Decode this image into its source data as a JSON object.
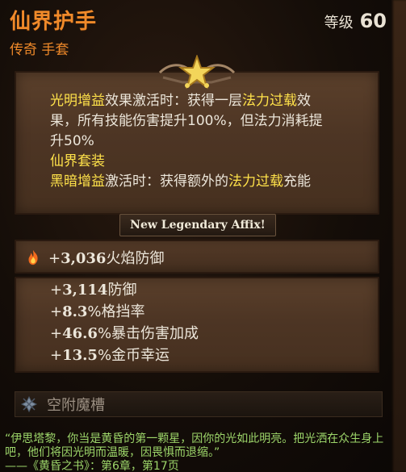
{
  "header": {
    "item_name": "仙界护手",
    "item_subtitle": "传奇 手套",
    "level_label": "等级",
    "level_value": "60"
  },
  "description": {
    "p1_hl": "光明增益",
    "p1_text": "效果激活时：获得一层",
    "p1_hl2": "法力过载",
    "p1_text2": "效果，所有技能伤害提升100%，但法力消耗提升50%",
    "set_label": "仙界套装",
    "p2_hl": "黑暗增益",
    "p2_text": "激活时：获得额外的",
    "p2_hl2": "法力过载",
    "p2_text2": "充能"
  },
  "affix_banner": "New Legendary Affix!",
  "fire_stat": {
    "prefix": "+",
    "value": "3,036",
    "label": "火焰防御",
    "icon": "fire-icon"
  },
  "stats": [
    {
      "prefix": "+",
      "value": "3,114",
      "label": "防御"
    },
    {
      "prefix": "+",
      "value": "8.3",
      "label": "%格挡率"
    },
    {
      "prefix": "+",
      "value": "46.6",
      "label": "%暴击伤害加成"
    },
    {
      "prefix": "+",
      "value": "13.5",
      "label": "%金币幸运"
    }
  ],
  "socket": {
    "label": "空附魔槽",
    "icon": "empty-socket-icon"
  },
  "flavor": {
    "quote": "“伊思塔黎，你当是黄昏的第一颗星，因你的光如此明亮。把光洒在众生身上吧，他们将因光明而温暖，因畏惧而退缩。”",
    "source": "——《黄昏之书》：第6章，第17页"
  },
  "colors": {
    "legendary_orange": "#f08a2a",
    "highlight_yellow": "#ffe24a",
    "flavor_green": "#9dd66a"
  }
}
